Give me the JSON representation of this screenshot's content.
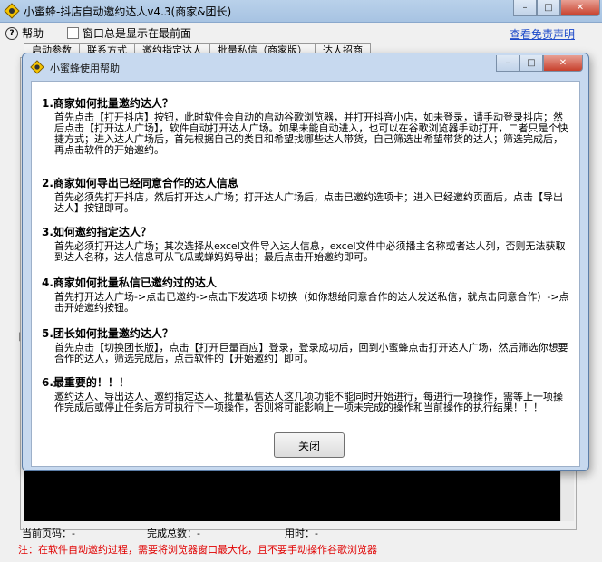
{
  "window": {
    "title": "小蜜蜂-抖店自动邀约达人v4.3(商家&团长)",
    "minimize_glyph": "–",
    "maximize_glyph": "□",
    "close_glyph": "✕"
  },
  "menu": {
    "help_glyph": "?",
    "help_label": "帮助",
    "topmost_label": "窗口总是显示在最前面",
    "free_link": "查看免责声明"
  },
  "tabs": [
    "启动参数",
    "联系方式",
    "邀约指定达人",
    "批量私信（商家版）",
    "达人招商"
  ],
  "status": {
    "current_page": "当前页码：-",
    "total_done": "完成总数：-",
    "elapsed": "用时：-",
    "warning": "注：在软件自动邀约过程，需要将浏览器窗口最大化，且不要手动操作谷歌浏览器"
  },
  "edge_mark": "|",
  "dialog": {
    "title": "小蜜蜂使用帮助",
    "minimize_glyph": "–",
    "maximize_glyph": "□",
    "close_glyph": "✕",
    "sections": [
      {
        "title": "1.商家如何批量邀约达人？",
        "body": "首先点击【打开抖店】按钮，此时软件会自动的启动谷歌浏览器，并打开抖音小店，如未登录，请手动登录抖店；然后点击【打开达人广场】，软件自动打开达人广场。如果未能自动进入，也可以在谷歌浏览器手动打开，二者只是个快捷方式；进入达人广场后，首先根据自己的类目和希望找哪些达人带货，自己筛选出希望带货的达人；筛选完成后，再点击软件的开始邀约。"
      },
      {
        "title": "2.商家如何导出已经同意合作的达人信息",
        "body": "首先必须先打开抖店，然后打开达人广场；打开达人广场后，点击已邀约选项卡；进入已经邀约页面后，点击【导出达人】按钮即可。"
      },
      {
        "title": "3.如何邀约指定达人？",
        "body": "首先必须打开达人广场；其次选择从excel文件导入达人信息，excel文件中必须播主名称或者达人列，否则无法获取到达人名称，达人信息可从飞瓜或蝉妈妈导出；最后点击开始邀约即可。"
      },
      {
        "title": "4.商家如何批量私信已邀约过的达人",
        "body": "首先打开达人广场->点击已邀约->点击下发选项卡切换（如你想给同意合作的达人发送私信，就点击同意合作）->点击开始邀约按钮。"
      },
      {
        "title": "5.团长如何批量邀约达人？",
        "body": "首先点击【切换团长版】，点击【打开巨量百应】登录，登录成功后，回到小蜜蜂点击打开达人广场，然后筛选你想要合作的达人，筛选完成后，点击软件的【开始邀约】即可。"
      },
      {
        "title": "6.最重要的！！！",
        "body": "邀约达人、导出达人、邀约指定达人、批量私信达人这几项功能不能同时开始进行，每进行一项操作，需等上一项操作完成后或停止任务后方可执行下一项操作，否则将可能影响上一项未完成的操作和当前操作的执行结果！！！"
      }
    ],
    "close_button": "关闭"
  },
  "colors": {
    "accent_link": "#1c49c9",
    "warning_text": "#e00000",
    "dialog_frame": "#c7d9ef"
  },
  "icons": [
    "bee-icon",
    "help-icon",
    "minimize-icon",
    "maximize-icon",
    "close-icon"
  ]
}
